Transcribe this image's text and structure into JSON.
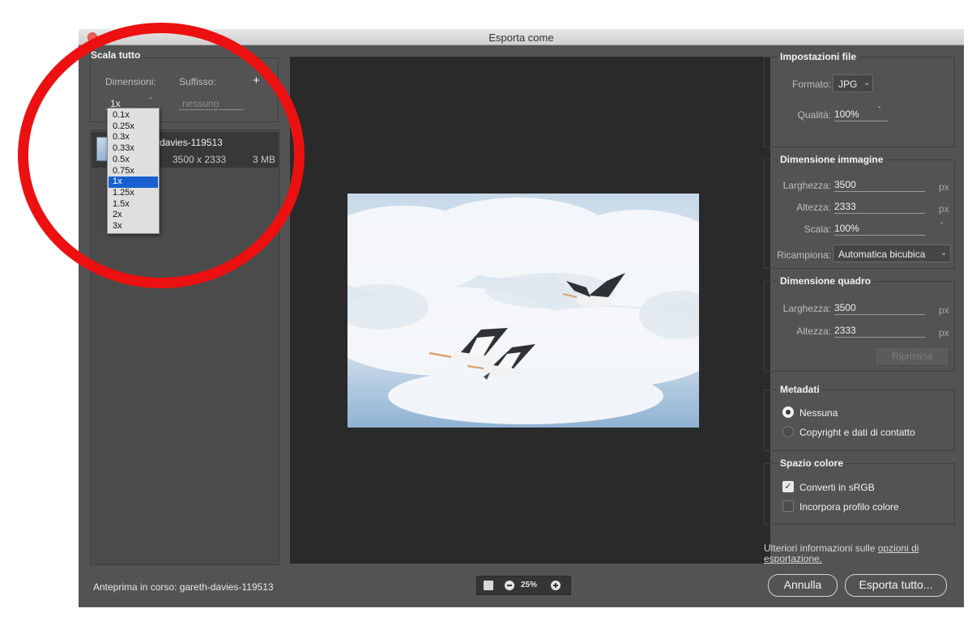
{
  "window": {
    "title": "Esporta come"
  },
  "left": {
    "scale_all_title": "Scala tutto",
    "dimensions_label": "Dimensioni:",
    "suffix_label": "Suffisso:",
    "add_symbol": "+",
    "scale_value": "1x",
    "suffix_placeholder": "nessuno",
    "scale_options": [
      "0.1x",
      "0.25x",
      "0.3x",
      "0.33x",
      "0.5x",
      "0.75x",
      "1x",
      "1.25x",
      "1.5x",
      "2x",
      "3x"
    ],
    "selected_option": "1x",
    "asset": {
      "name": "davies-119513",
      "size": "3500 x 2333",
      "weight": "3 MB"
    }
  },
  "center": {
    "zoom": "25%"
  },
  "file_settings": {
    "title": "Impostazioni file",
    "format_label": "Formato:",
    "format_value": "JPG",
    "quality_label": "Qualità:",
    "quality_value": "100%"
  },
  "image_size": {
    "title": "Dimensione immagine",
    "width_label": "Larghezza:",
    "width_value": "3500",
    "height_label": "Altezza:",
    "height_value": "2333",
    "scale_label": "Scala:",
    "scale_value": "100%",
    "resample_label": "Ricampiona:",
    "resample_value": "Automatica bicubica",
    "unit": "px"
  },
  "canvas_size": {
    "title": "Dimensione quadro",
    "width_label": "Larghezza:",
    "width_value": "3500",
    "height_label": "Altezza:",
    "height_value": "2333",
    "unit": "px",
    "reset_label": "Ripristina"
  },
  "metadata": {
    "title": "Metadati",
    "options": [
      "Nessuna",
      "Copyright e dati di contatto"
    ],
    "selected": "Nessuna"
  },
  "color_space": {
    "title": "Spazio colore",
    "convert_label": "Converti in sRGB",
    "convert_checked": true,
    "embed_label": "Incorpora profilo colore",
    "embed_checked": false
  },
  "footer": {
    "more_info_prefix": "Ulteriori informazioni sulle ",
    "more_info_link": "opzioni di esportazione.",
    "preview_status": "Anteprima in corso: gareth-davies-119513",
    "cancel_label": "Annulla",
    "export_label": "Esporta tutto..."
  },
  "annotation_color": "#ec1010"
}
